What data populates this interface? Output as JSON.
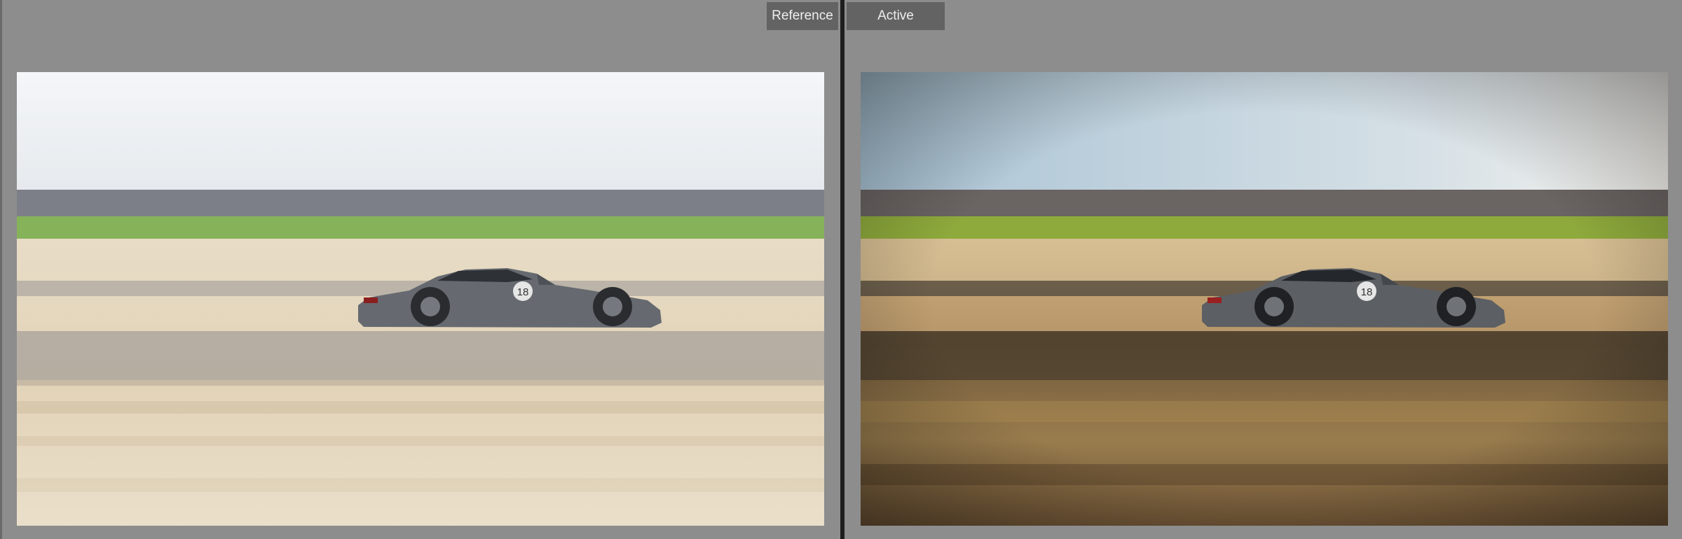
{
  "compare": {
    "reference_label": "Reference",
    "active_label": "Active"
  },
  "photo": {
    "car_number": "18"
  },
  "colors": {
    "background": "#8a8a8a",
    "divider": "#1e1e1e",
    "label_bg": "#636363",
    "label_text": "#eeeeee"
  }
}
